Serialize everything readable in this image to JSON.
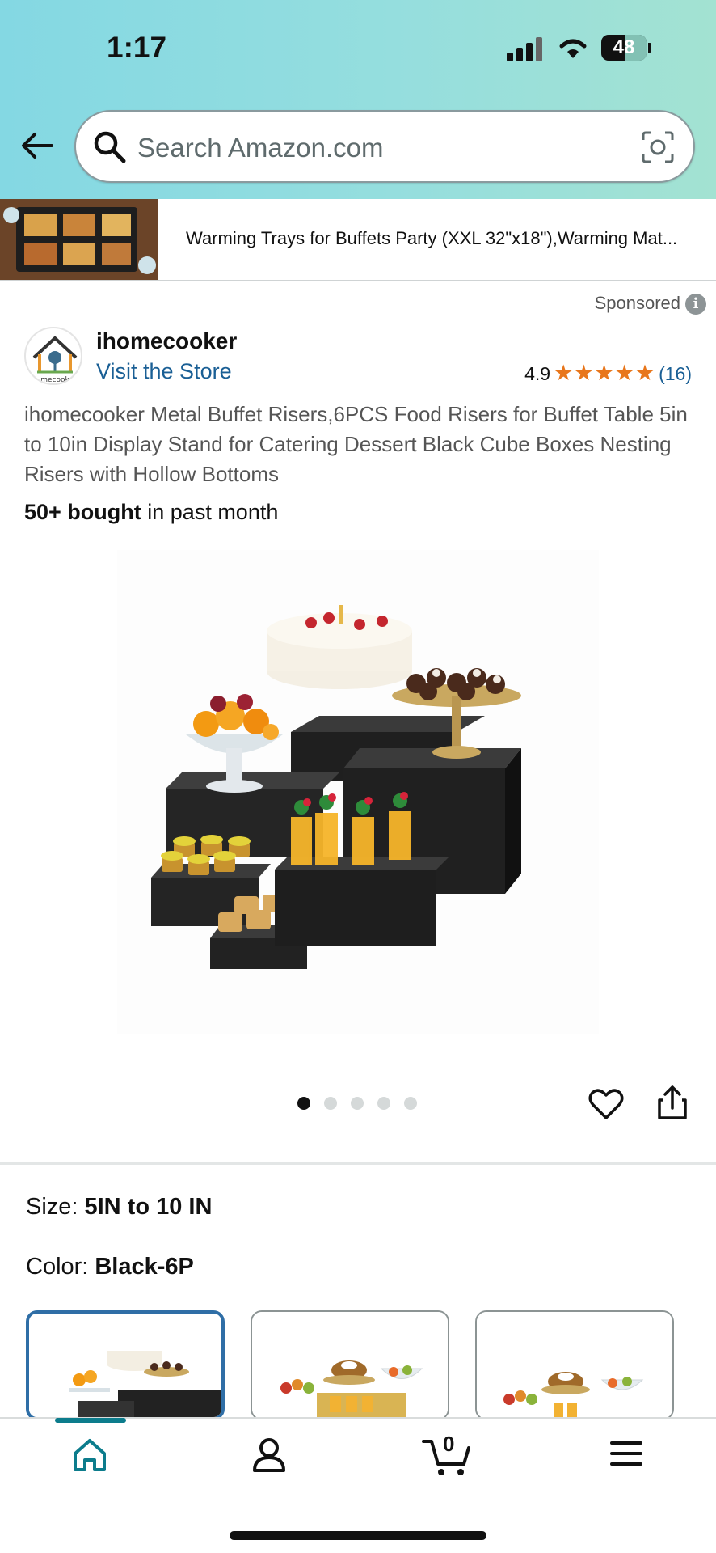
{
  "status": {
    "time": "1:17",
    "battery": "48"
  },
  "search": {
    "placeholder": "Search Amazon.com"
  },
  "promo": {
    "text": "Warming Trays for Buffets Party (XXL 32\"x18\"),Warming Mat..."
  },
  "sponsored": {
    "label": "Sponsored",
    "info": "i"
  },
  "store": {
    "brand": "ihomecooker",
    "visit": "Visit the Store",
    "logo_text": "mecook"
  },
  "rating": {
    "value": "4.9",
    "stars": 5,
    "count": "(16)"
  },
  "product": {
    "title": "ihomecooker Metal Buffet Risers,6PCS Food Risers for Buffet Table 5in to 10in Display Stand for Catering Dessert Black Cube Boxes Nesting Risers with Hollow Bottoms",
    "bought_bold": "50+ bought",
    "bought_rest": " in past month"
  },
  "carousel": {
    "count": 5,
    "active": 0
  },
  "options": {
    "size_label": "Size:",
    "size_value": "5IN to 10 IN",
    "color_label": "Color:",
    "color_value": "Black-6P"
  },
  "nav": {
    "cart_count": "0",
    "items": [
      "home-icon",
      "account-icon",
      "cart-icon",
      "menu-icon"
    ]
  },
  "colors": {
    "accent": "#0c7c8c",
    "link": "#1a5f95",
    "star": "#e8761b"
  }
}
